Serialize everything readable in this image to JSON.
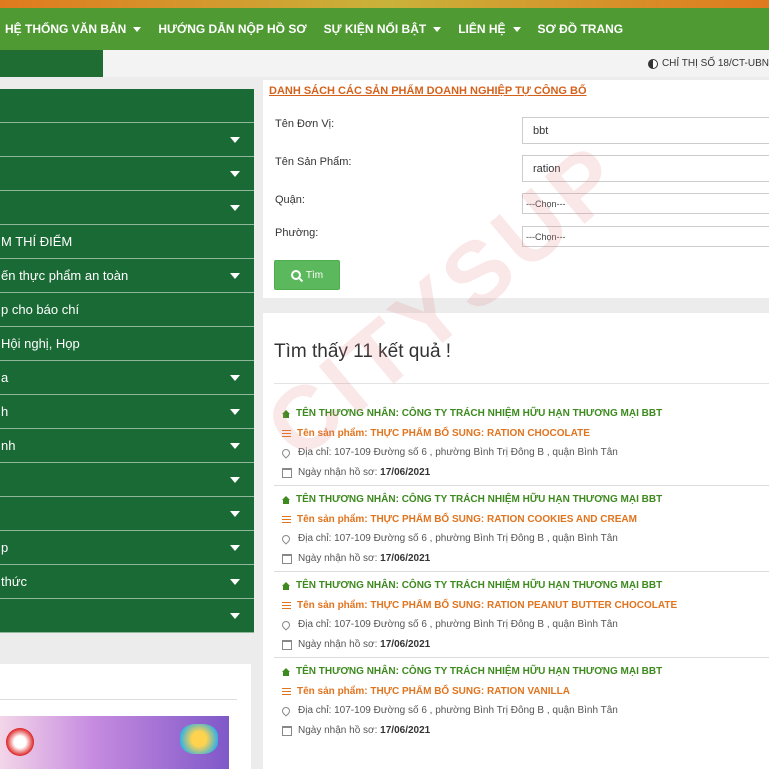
{
  "nav": {
    "items": [
      {
        "label": "HỆ THỐNG VĂN BẢN",
        "has_dropdown": true
      },
      {
        "label": "HƯỚNG DẪN NỘP HỒ SƠ",
        "has_dropdown": false
      },
      {
        "label": "SỰ KIỆN NỔI BẬT",
        "has_dropdown": true
      },
      {
        "label": "LIÊN HỆ",
        "has_dropdown": true
      },
      {
        "label": "SƠ ĐỒ TRANG",
        "has_dropdown": false
      }
    ]
  },
  "notice": {
    "text": "CHỈ THỊ SỐ 18/CT-UBN"
  },
  "sidebar": {
    "items": [
      {
        "label": ""
      },
      {
        "label": ""
      },
      {
        "label": ""
      },
      {
        "label": ""
      },
      {
        "label": "M THÍ ĐIỂM"
      },
      {
        "label": "ến thực phẩm an toàn"
      },
      {
        "label": "p cho báo chí"
      },
      {
        "label": "Hội nghị, Họp"
      },
      {
        "label": "a"
      },
      {
        "label": "h"
      },
      {
        "label": "nh"
      },
      {
        "label": ""
      },
      {
        "label": ""
      },
      {
        "label": "p"
      },
      {
        "label": "thức"
      },
      {
        "label": ""
      }
    ]
  },
  "search": {
    "title": "DANH SÁCH CÁC SẢN PHẨM DOANH NGHIỆP TỰ CÔNG BỐ",
    "unit_label": "Tên Đơn Vị:",
    "unit_value": "bbt",
    "product_label": "Tên Sản Phẩm:",
    "product_value": "ration",
    "district_label": "Quận:",
    "district_value": "---Chọn---",
    "ward_label": "Phường:",
    "ward_value": "---Chọn---",
    "button_label": "Tìm"
  },
  "results": {
    "title": "Tìm thấy 11 kết quả !",
    "items": [
      {
        "merchant": "TÊN THƯƠNG NHÂN: CÔNG TY TRÁCH NHIỆM HỮU HẠN THƯƠNG MẠI BBT",
        "product": "Tên sản phẩm: THỰC PHẨM BỔ SUNG: RATION CHOCOLATE",
        "address": "Địa chỉ: 107-109 Đường số 6 , phường Bình Trị Đông B , quận Bình Tân",
        "date_label": "Ngày nhận hồ sơ:",
        "date": "17/06/2021"
      },
      {
        "merchant": "TÊN THƯƠNG NHÂN: CÔNG TY TRÁCH NHIỆM HỮU HẠN THƯƠNG MẠI BBT",
        "product": "Tên sản phẩm: THỰC PHẨM BỔ SUNG: RATION COOKIES AND CREAM",
        "address": "Địa chỉ: 107-109 Đường số 6 , phường Bình Trị Đông B , quận Bình Tân",
        "date_label": "Ngày nhận hồ sơ:",
        "date": "17/06/2021"
      },
      {
        "merchant": "TÊN THƯƠNG NHÂN: CÔNG TY TRÁCH NHIỆM HỮU HẠN THƯƠNG MẠI BBT",
        "product": "Tên sản phẩm: THỰC PHẨM BỔ SUNG: RATION PEANUT BUTTER CHOCOLATE",
        "address": "Địa chỉ: 107-109 Đường số 6 , phường Bình Trị Đông B , quận Bình Tân",
        "date_label": "Ngày nhận hồ sơ:",
        "date": "17/06/2021"
      },
      {
        "merchant": "TÊN THƯƠNG NHÂN: CÔNG TY TRÁCH NHIỆM HỮU HẠN THƯƠNG MẠI BBT",
        "product": "Tên sản phẩm: THỰC PHẨM BỔ SUNG: RATION VANILLA",
        "address": "Địa chỉ: 107-109 Đường số 6 , phường Bình Trị Đông B , quận Bình Tân",
        "date_label": "Ngày nhận hồ sơ:",
        "date": "17/06/2021"
      }
    ]
  },
  "watermark": {
    "text": "CITYSUP"
  },
  "colors": {
    "nav_green": "#4f9a33",
    "sidebar_green": "#1a6a35",
    "accent_orange": "#e0741f",
    "merchant_green": "#3d8a1f"
  }
}
